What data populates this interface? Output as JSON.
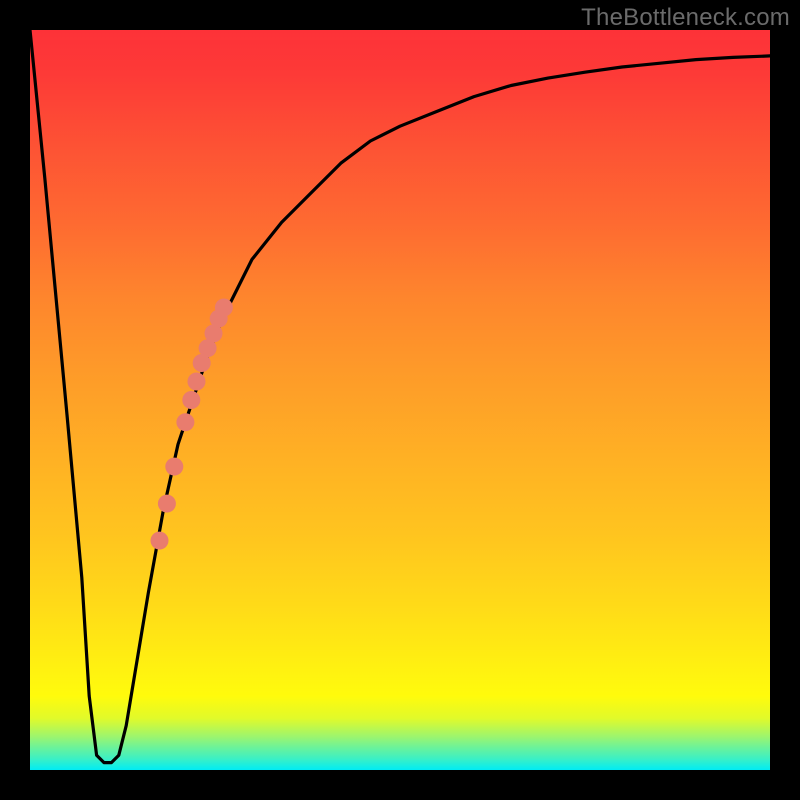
{
  "watermark_text": "TheBottleneck.com",
  "colors": {
    "frame": "#000000",
    "curve": "#000000",
    "marker": "#e97c6e"
  },
  "chart_data": {
    "type": "line",
    "title": "",
    "xlabel": "",
    "ylabel": "",
    "xlim": [
      0,
      100
    ],
    "ylim": [
      0,
      100
    ],
    "gradient_meaning": "background hue ~ bottleneck severity (green=0%, red=100%)",
    "series": [
      {
        "name": "bottleneck-curve",
        "x": [
          0,
          2,
          5,
          7,
          8,
          9,
          10,
          11,
          12,
          13,
          14,
          16,
          18,
          20,
          22,
          24,
          26,
          28,
          30,
          34,
          38,
          42,
          46,
          50,
          55,
          60,
          65,
          70,
          75,
          80,
          85,
          90,
          95,
          100
        ],
        "y": [
          100,
          80,
          48,
          26,
          10,
          2,
          1,
          1,
          2,
          6,
          12,
          24,
          35,
          44,
          50,
          56,
          61,
          65,
          69,
          74,
          78,
          82,
          85,
          87,
          89,
          91,
          92.5,
          93.5,
          94.3,
          95,
          95.5,
          96,
          96.3,
          96.5
        ]
      }
    ],
    "markers": {
      "name": "highlighted-points",
      "color": "#e97c6e",
      "points": [
        {
          "x": 17.5,
          "y": 31
        },
        {
          "x": 18.5,
          "y": 36
        },
        {
          "x": 19.5,
          "y": 41
        },
        {
          "x": 21.0,
          "y": 47
        },
        {
          "x": 21.8,
          "y": 50
        },
        {
          "x": 22.5,
          "y": 52.5
        },
        {
          "x": 23.2,
          "y": 55
        },
        {
          "x": 24.0,
          "y": 57
        },
        {
          "x": 24.8,
          "y": 59
        },
        {
          "x": 25.5,
          "y": 61
        },
        {
          "x": 26.2,
          "y": 62.5
        }
      ]
    }
  }
}
